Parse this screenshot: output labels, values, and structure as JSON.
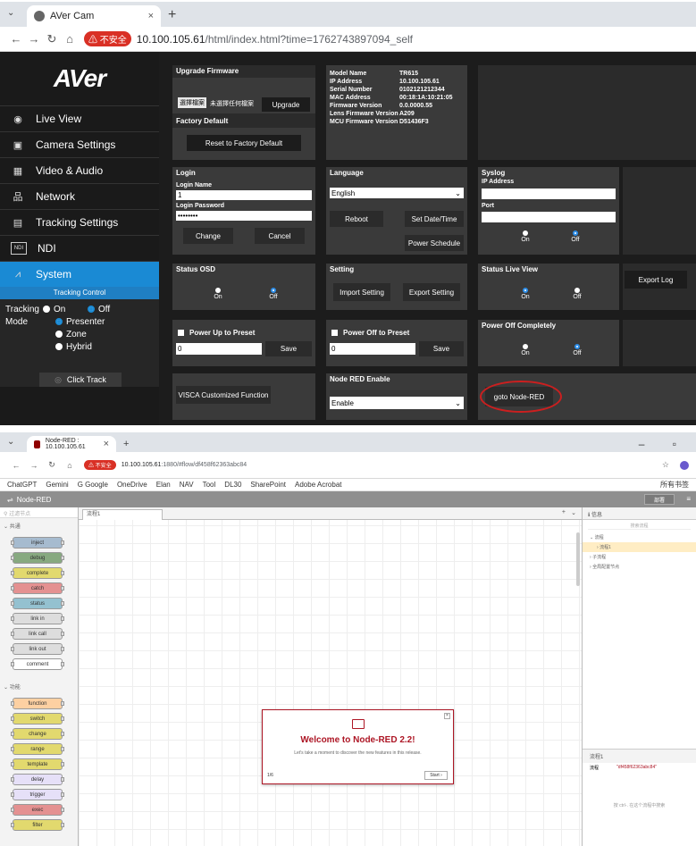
{
  "browser1": {
    "tab_title": "AVer Cam",
    "tab_close": "×",
    "new_tab": "+",
    "security": "不安全",
    "url_host": "10.100.105.61",
    "url_path": "/html/index.html?time=1762743897094_self"
  },
  "aver": {
    "logo": "AVer",
    "menu": [
      "Live View",
      "Camera Settings",
      "Video & Audio",
      "Network",
      "Tracking Settings",
      "NDI",
      "System"
    ],
    "ndi_icon": "NDI",
    "tracking_control_title": "Tracking Control",
    "tracking_label": "Tracking",
    "tracking_on": "On",
    "tracking_off": "Off",
    "mode_label": "Mode",
    "modes": [
      "Presenter",
      "Zone",
      "Hybrid"
    ],
    "click_track": "Click Track",
    "upgrade": {
      "title": "Upgrade Firmware",
      "choose_file": "選擇檔案",
      "no_file": "未選擇任何檔案",
      "button": "Upgrade"
    },
    "factory": {
      "title": "Factory Default",
      "button": "Reset to Factory Default"
    },
    "device_info": [
      {
        "k": "Model Name",
        "v": "TR615"
      },
      {
        "k": "IP Address",
        "v": "10.100.105.61"
      },
      {
        "k": "Serial Number",
        "v": "0102121212344"
      },
      {
        "k": "MAC Address",
        "v": "00:18:1A:10:21:05"
      },
      {
        "k": "Firmware Version",
        "v": "0.0.0000.55"
      },
      {
        "k": "Lens Firmware Version",
        "v": "A209"
      },
      {
        "k": "MCU Firmware Version",
        "v": "D51436F3"
      }
    ],
    "login": {
      "title": "Login",
      "name_label": "Login Name",
      "name_value": "1",
      "pw_label": "Login Password",
      "pw_value": "••••••••",
      "change": "Change",
      "cancel": "Cancel"
    },
    "language": {
      "title": "Language",
      "value": "English",
      "reboot": "Reboot",
      "set_date": "Set Date/Time",
      "power_schedule": "Power Schedule"
    },
    "syslog": {
      "title": "Syslog",
      "ip_label": "IP Address",
      "port_label": "Port",
      "on": "On",
      "off": "Off"
    },
    "status_osd": {
      "title": "Status OSD",
      "on": "On",
      "off": "Off"
    },
    "setting": {
      "title": "Setting",
      "import": "Import Setting",
      "export": "Export Setting"
    },
    "status_live": {
      "title": "Status Live View",
      "on": "On",
      "off": "Off"
    },
    "export_log": "Export Log",
    "power_up": {
      "label": "Power Up to Preset",
      "value": "0",
      "save": "Save"
    },
    "power_off": {
      "label": "Power Off to Preset",
      "value": "0",
      "save": "Save"
    },
    "power_off_completely": {
      "title": "Power Off Completely",
      "on": "On",
      "off": "Off"
    },
    "visca": "VISCA Customized Function",
    "node_red": {
      "title": "Node RED Enable",
      "value": "Enable",
      "goto": "goto Node-RED"
    }
  },
  "browser2": {
    "tab_title": "Node-RED : 10.100.105.61",
    "tab_close": "×",
    "new_tab": "+",
    "security": "不安全",
    "url_host": "10.100.105.61",
    "url_path": ":1880/#flow/df458f62363abc84",
    "bookmarks": [
      "ChatGPT",
      "Gemini",
      "G Google",
      "OneDrive",
      "Elan",
      "NAV",
      "Tool",
      "DL30",
      "SharePoint",
      "Adobe Acrobat"
    ],
    "bookmarks_right": "所有书签"
  },
  "nodered": {
    "title": "Node-RED",
    "deploy": "部署",
    "palette_search": "过滤节点",
    "cat_common": "共通",
    "common_nodes": [
      "inject",
      "debug",
      "complete",
      "catch",
      "status",
      "link in",
      "link call",
      "link out",
      "comment"
    ],
    "cat_function": "功能",
    "function_nodes": [
      "function",
      "switch",
      "change",
      "range",
      "template",
      "delay",
      "trigger",
      "exec",
      "filter"
    ],
    "flow_tab": "流程1",
    "welcome_title": "Welcome to Node-RED 2.2!",
    "welcome_text": "Let's take a moment to discover the new features in this release.",
    "welcome_page": "1/6",
    "welcome_start": "Start",
    "sidebar_tab": "信息",
    "sidebar_search": "搜索流程",
    "tree": [
      "流程",
      "流程1",
      "子流程",
      "全局配置节点"
    ],
    "info_title": "流程1",
    "info_key": "流程",
    "info_val": "\"df458f62363abc84\"",
    "hint": "按 ctrl-. 在这个流程中搜索"
  }
}
